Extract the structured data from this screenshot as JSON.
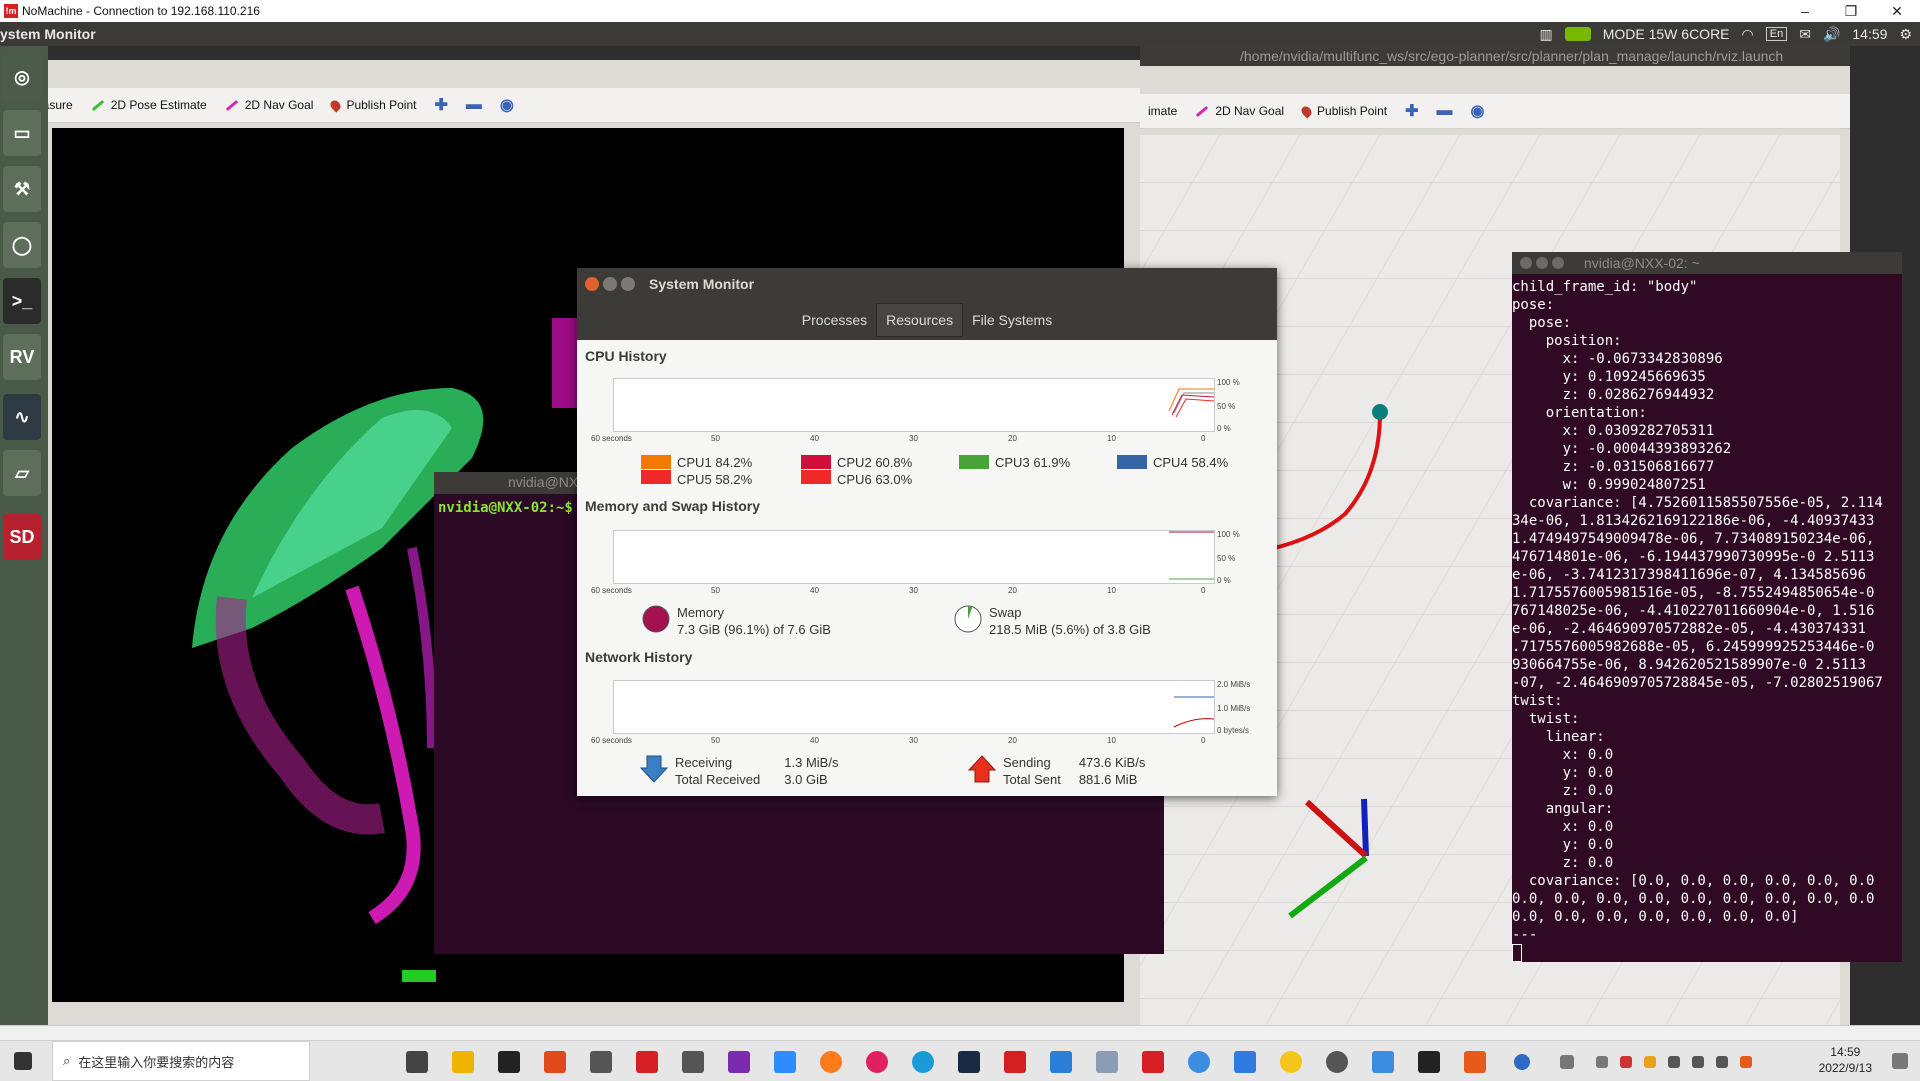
{
  "nx": {
    "title": "NoMachine - Connection to 192.168.110.216",
    "min": "–",
    "max": "❐",
    "close": "✕"
  },
  "panel": {
    "title": "ystem Monitor",
    "mode": "MODE 15W 6CORE",
    "lang": "En",
    "time": "14:59"
  },
  "rviz_left": {
    "tools": {
      "measure": "Measure",
      "pose": "2D Pose Estimate",
      "nav": "2D Nav Goal",
      "publish": "Publish Point"
    }
  },
  "rviz_right": {
    "title": "/home/nvidia/multifunc_ws/src/ego-planner/src/planner/plan_manage/launch/rviz.launch",
    "tools": {
      "pose": "imate",
      "nav": "2D Nav Goal",
      "publish": "Publish Point"
    }
  },
  "term_mid": {
    "title": "nvidia@NX",
    "prompt": "nvidia@NXX-02:~$"
  },
  "term_right": {
    "title": "nvidia@NXX-02: ~",
    "lines": [
      "child_frame_id: \"body\"",
      "pose:",
      "  pose:",
      "    position:",
      "      x: -0.0673342830896",
      "      y: 0.109245669635",
      "      z: 0.0286276944932",
      "    orientation:",
      "      x: 0.0309282705311",
      "      y: -0.00044393893262",
      "      z: -0.031506816677",
      "      w: 0.999024807251",
      "  covariance: [4.7526011585507556e-05, 2.114",
      "34e-06, 1.8134262169122186e-06, -4.40937433",
      "1.4749497549009478e-06, 7.734089150234e-06,",
      "476714801e-06, -6.194437990730995e-0 2.5113",
      "e-06, -3.7412317398411696e-07, 4.134585696",
      "1.7175576005981516e-05, -8.7552494850654e-0",
      "767148025e-06, -4.410227011660904e-0, 1.516",
      "e-06, -2.464690970572882e-05, -4.430374331",
      ".7175576005982688e-05, 6.245999925253446e-0",
      "930664755e-06, 8.942620521589907e-0 2.5113",
      "-07, -2.4646909705728845e-05, -7.02802519067",
      "twist:",
      "  twist:",
      "    linear:",
      "      x: 0.0",
      "      y: 0.0",
      "      z: 0.0",
      "    angular:",
      "      x: 0.0",
      "      y: 0.0",
      "      z: 0.0",
      "  covariance: [0.0, 0.0, 0.0, 0.0, 0.0, 0.0",
      "0.0, 0.0, 0.0, 0.0, 0.0, 0.0, 0.0, 0.0, 0.0",
      "0.0, 0.0, 0.0, 0.0, 0.0, 0.0, 0.0]",
      "---"
    ]
  },
  "sysmon": {
    "title": "System Monitor",
    "tabs": [
      "Processes",
      "Resources",
      "File Systems"
    ],
    "cpu_title": "CPU History",
    "mem_title": "Memory and Swap History",
    "net_title": "Network History",
    "axis": [
      "60 seconds",
      "50",
      "40",
      "30",
      "20",
      "10",
      "0"
    ],
    "pct_labels": [
      "100 %",
      "50 %",
      "0 %"
    ],
    "net_labels": [
      "2.0 MiB/s",
      "1.0 MiB/s",
      "0 bytes/s"
    ],
    "cpus": [
      {
        "name": "CPU1",
        "value": "84.2%",
        "color": "#f57900"
      },
      {
        "name": "CPU2",
        "value": "60.8%",
        "color": "#d0103a"
      },
      {
        "name": "CPU3",
        "value": "61.9%",
        "color": "#4aa33a"
      },
      {
        "name": "CPU4",
        "value": "58.4%",
        "color": "#3465a4"
      },
      {
        "name": "CPU5",
        "value": "58.2%",
        "color": "#ef2929"
      },
      {
        "name": "CPU6",
        "value": "63.0%",
        "color": "#ef2929"
      }
    ],
    "memory": {
      "label": "Memory",
      "value": "7.3 GiB (96.1%) of 7.6 GiB",
      "fraction": 0.961,
      "color": "#a3114f"
    },
    "swap": {
      "label": "Swap",
      "value": "218.5 MiB (5.6%) of 3.8 GiB",
      "fraction": 0.056,
      "color": "#4aa33a"
    },
    "network": {
      "receiving_label": "Receiving",
      "receiving": "1.3 MiB/s",
      "total_received_label": "Total Received",
      "total_received": "3.0 GiB",
      "sending_label": "Sending",
      "sending": "473.6 KiB/s",
      "total_sent_label": "Total Sent",
      "total_sent": "881.6 MiB"
    }
  },
  "taskbar": {
    "search_placeholder": "在这里输入你要搜索的内容",
    "time": "14:59",
    "date": "2022/9/13"
  }
}
